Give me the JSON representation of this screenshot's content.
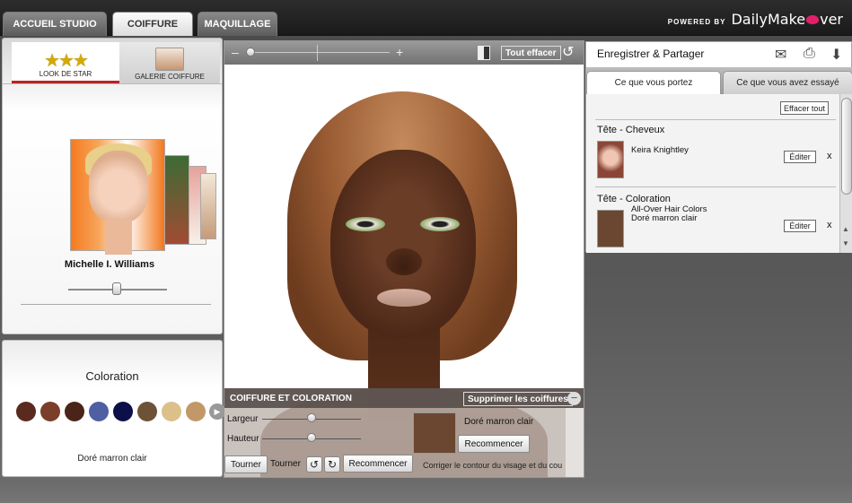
{
  "topbar": {
    "tabs": [
      {
        "label": "ACCUEIL STUDIO"
      },
      {
        "label": "COIFFURE"
      },
      {
        "label": "MAQUILLAGE"
      }
    ],
    "powered_by": "POWERED BY",
    "brand_part1": "DailyMake",
    "brand_part2": "ver"
  },
  "left": {
    "tab_look": "LOOK DE STAR",
    "tab_gallery": "GALERIE COIFFURE",
    "star_name": "Michelle I. Williams",
    "coloration_title": "Coloration",
    "swatches": [
      "#5a2a1e",
      "#7a3e2a",
      "#4a2418",
      "#4f5fa3",
      "#0c0f48",
      "#6e5237",
      "#dcc08a",
      "#c29868"
    ],
    "selected_color": "Doré marron clair"
  },
  "center": {
    "zoom_minus": "–",
    "zoom_plus": "+",
    "tout_effacer": "Tout effacer",
    "panel_title": "COIFFURE ET COLORATION",
    "supprimer": "Supprimer les coiffures",
    "largeur": "Largeur",
    "hauteur": "Hauteur",
    "color_label": "Doré marron clair",
    "recommencer1": "Recommencer",
    "tourner_btn": "Tourner",
    "tourner_lbl": "Tourner",
    "recommencer2": "Recommencer",
    "contour": "Corriger le contour du visage et du cou"
  },
  "right": {
    "title": "Enregistrer & Partager",
    "tab_wearing": "Ce que vous portez",
    "tab_tried": "Ce que vous avez essayé",
    "effacer_tout": "Effacer tout",
    "items": [
      {
        "section": "Tête - Cheveux",
        "line1": "Keira Knightley",
        "line2": "",
        "edit": "Éditer",
        "x": "x"
      },
      {
        "section": "Tête - Coloration",
        "line1": "All-Over Hair Colors",
        "line2": "Doré marron clair",
        "edit": "Éditer",
        "x": "x"
      }
    ]
  }
}
